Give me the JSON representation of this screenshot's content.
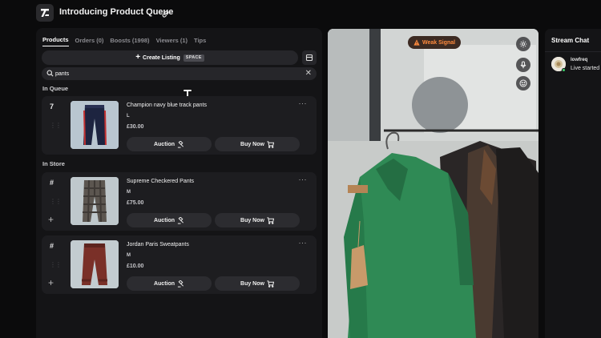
{
  "header": {
    "title": "Introducing Product Queue",
    "logo_icon": "logo-icon",
    "link_icon": "link-icon"
  },
  "tabs": [
    {
      "label": "Products",
      "active": true
    },
    {
      "label": "Orders (0)",
      "active": false
    },
    {
      "label": "Boosts (1998)",
      "active": false
    },
    {
      "label": "Viewers (1)",
      "active": false
    },
    {
      "label": "Tips",
      "active": false
    }
  ],
  "create_listing": {
    "label": "Create Listing",
    "shortcut": "SPACE"
  },
  "search": {
    "value": "pants",
    "placeholder": ""
  },
  "sections": {
    "queue_label": "In Queue",
    "store_label": "In Store"
  },
  "queue_items": [
    {
      "index": "7",
      "name": "Champion navy blue track pants",
      "size": "L",
      "price": "£30.00",
      "auction_label": "Auction",
      "buy_label": "Buy Now"
    }
  ],
  "store_items": [
    {
      "index": "#",
      "name": "Supreme Checkered Pants",
      "size": "M",
      "price": "£75.00",
      "auction_label": "Auction",
      "buy_label": "Buy Now"
    },
    {
      "index": "#",
      "name": "Jordan Paris Sweatpants",
      "size": "M",
      "price": "£10.00",
      "auction_label": "Auction",
      "buy_label": "Buy Now"
    }
  ],
  "video": {
    "signal_label": "Weak Signal",
    "signal_color": "#ff8a3d"
  },
  "chat": {
    "title": "Stream Chat",
    "messages": [
      {
        "user": "lowfreq",
        "text": "Live started"
      }
    ]
  },
  "colors": {
    "background": "#0b0b0c",
    "panel": "#141416",
    "card": "#1d1d20",
    "button": "#2c2c30",
    "online": "#3ccf6a"
  }
}
